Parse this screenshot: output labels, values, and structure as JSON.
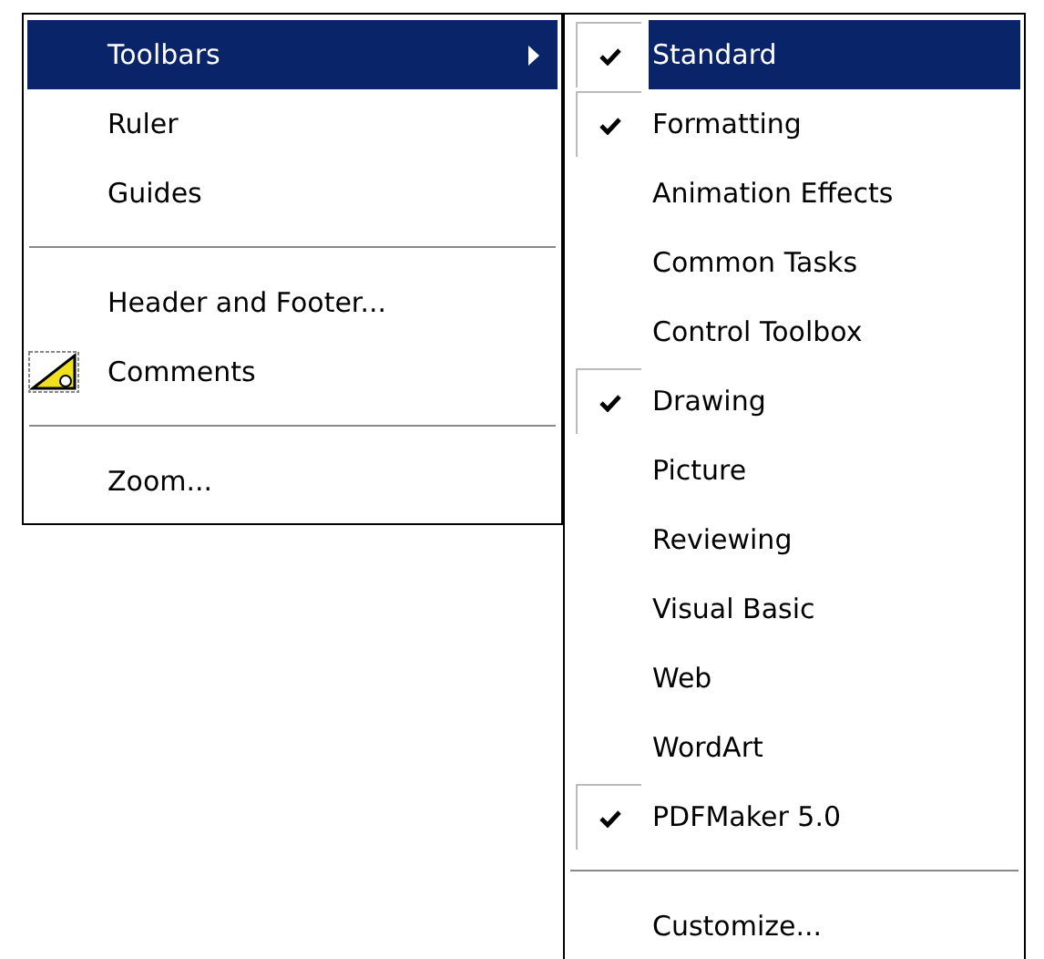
{
  "menu": {
    "items": [
      {
        "kind": "submenu",
        "label": "Toolbars",
        "selected": true
      },
      {
        "kind": "item",
        "label": "Ruler",
        "selected": false
      },
      {
        "kind": "item",
        "label": "Guides",
        "selected": false
      },
      {
        "kind": "separator"
      },
      {
        "kind": "item",
        "label": "Header and Footer...",
        "selected": false
      },
      {
        "kind": "icon",
        "label": "Comments",
        "selected": false
      },
      {
        "kind": "separator"
      },
      {
        "kind": "item",
        "label": "Zoom...",
        "selected": false
      }
    ]
  },
  "submenu": {
    "items": [
      {
        "kind": "check",
        "label": "Standard",
        "checked": true,
        "selected": true
      },
      {
        "kind": "check",
        "label": "Formatting",
        "checked": true,
        "selected": false
      },
      {
        "kind": "check",
        "label": "Animation Effects",
        "checked": false,
        "selected": false
      },
      {
        "kind": "check",
        "label": "Common Tasks",
        "checked": false,
        "selected": false
      },
      {
        "kind": "check",
        "label": "Control Toolbox",
        "checked": false,
        "selected": false
      },
      {
        "kind": "check",
        "label": "Drawing",
        "checked": true,
        "selected": false
      },
      {
        "kind": "check",
        "label": "Picture",
        "checked": false,
        "selected": false
      },
      {
        "kind": "check",
        "label": "Reviewing",
        "checked": false,
        "selected": false
      },
      {
        "kind": "check",
        "label": "Visual Basic",
        "checked": false,
        "selected": false
      },
      {
        "kind": "check",
        "label": "Web",
        "checked": false,
        "selected": false
      },
      {
        "kind": "check",
        "label": "WordArt",
        "checked": false,
        "selected": false
      },
      {
        "kind": "check",
        "label": "PDFMaker 5.0",
        "checked": true,
        "selected": false
      },
      {
        "kind": "separator"
      },
      {
        "kind": "item",
        "label": "Customize...",
        "selected": false
      }
    ]
  }
}
